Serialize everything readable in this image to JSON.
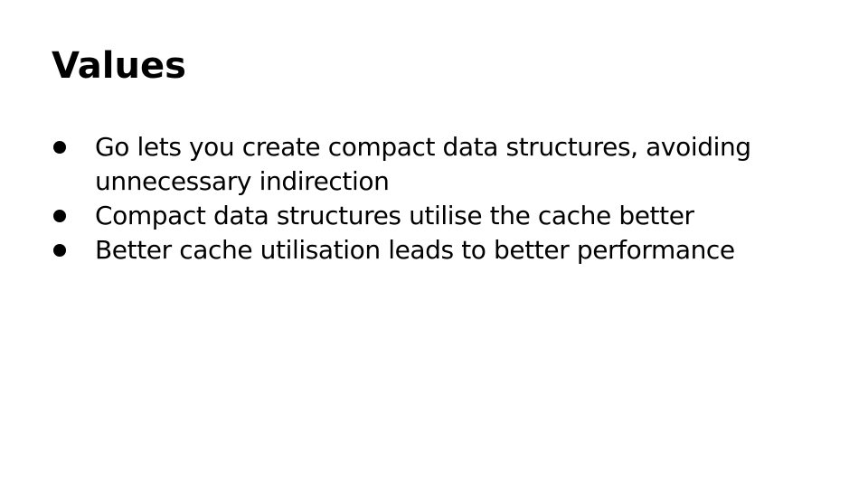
{
  "slide": {
    "title": "Values",
    "bullets": [
      "Go lets you create compact data structures, avoiding unnecessary indirection",
      "Compact data structures utilise the cache better",
      "Better cache utilisation leads to better performance"
    ]
  }
}
